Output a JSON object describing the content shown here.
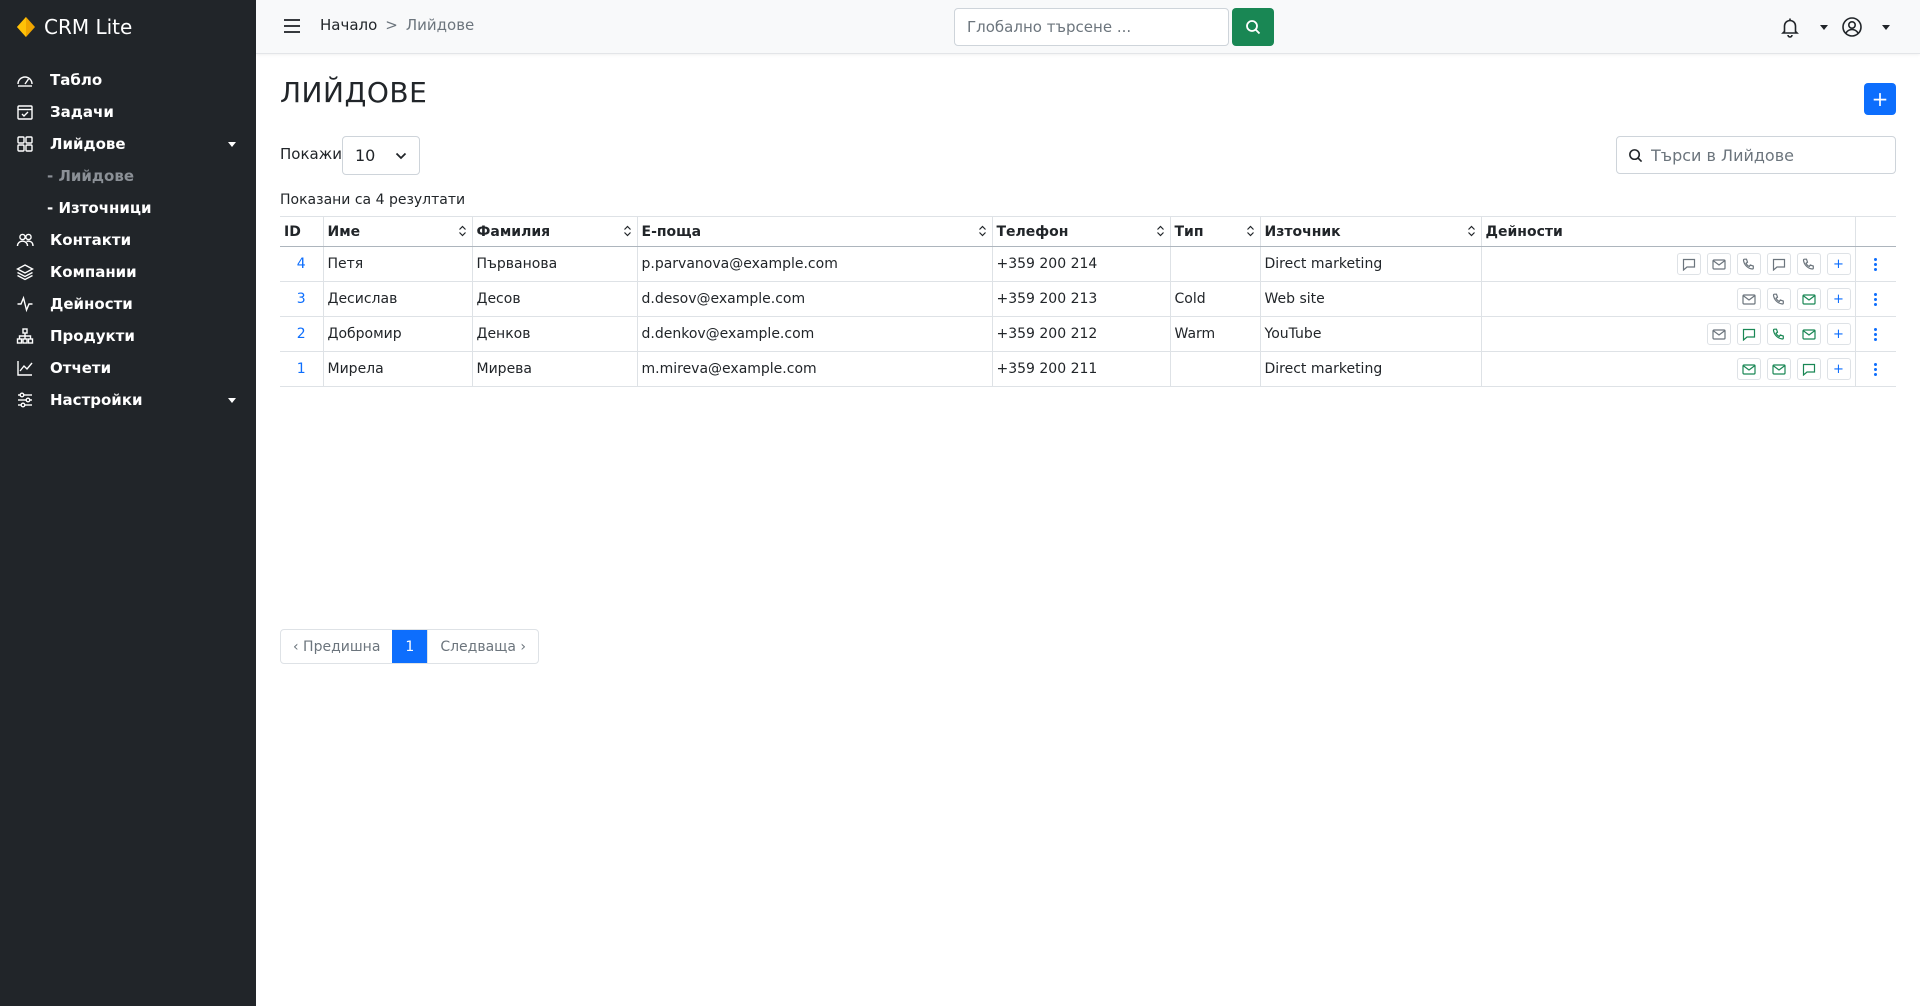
{
  "app": {
    "name": "CRM Lite"
  },
  "sidebar": {
    "items": [
      {
        "label": "Табло",
        "icon": "dashboard-icon"
      },
      {
        "label": "Задачи",
        "icon": "calendar-check-icon"
      },
      {
        "label": "Лийдове",
        "icon": "grid-icon",
        "expanded": true
      },
      {
        "label": "Контакти",
        "icon": "people-icon"
      },
      {
        "label": "Компании",
        "icon": "layers-icon"
      },
      {
        "label": "Дейности",
        "icon": "activity-icon"
      },
      {
        "label": "Продукти",
        "icon": "diagram-icon"
      },
      {
        "label": "Отчети",
        "icon": "line-chart-icon"
      },
      {
        "label": "Настройки",
        "icon": "sliders-icon",
        "has_submenu": true
      }
    ],
    "leads_subitems": [
      {
        "label": "- Лийдове",
        "active": true
      },
      {
        "label": "- Източници",
        "active": false
      }
    ]
  },
  "topbar": {
    "breadcrumb_home": "Начало",
    "breadcrumb_sep": ">",
    "breadcrumb_current": "Лийдове",
    "search_placeholder": "Глобално търсене ...",
    "search_button_color": "#198754"
  },
  "main": {
    "title": "ЛИЙДОВЕ",
    "show_label": "Покажи",
    "page_size": "10",
    "search_placeholder": "Търси в Лийдове",
    "results_text": "Показани са 4 резултати",
    "accent_color": "#0d6efd"
  },
  "table": {
    "columns": [
      "ID",
      "Име",
      "Фамилия",
      "Е-поща",
      "Телефон",
      "Тип",
      "Източник",
      "Дейности"
    ],
    "rows": [
      {
        "id": "4",
        "first": "Петя",
        "last": "Първанова",
        "email": "p.parvanova@example.com",
        "phone": "+359 200 214",
        "type": "",
        "source": "Direct marketing",
        "activities": [
          {
            "icon": "chat-icon",
            "color": "#6c757d"
          },
          {
            "icon": "envelope-icon",
            "color": "#6c757d"
          },
          {
            "icon": "phone-icon",
            "color": "#6c757d"
          },
          {
            "icon": "chat-icon",
            "color": "#6c757d"
          },
          {
            "icon": "phone-icon",
            "color": "#6c757d"
          }
        ]
      },
      {
        "id": "3",
        "first": "Десислав",
        "last": "Десов",
        "email": "d.desov@example.com",
        "phone": "+359 200 213",
        "type": "Cold",
        "source": "Web site",
        "activities": [
          {
            "icon": "envelope-icon",
            "color": "#6c757d"
          },
          {
            "icon": "phone-icon",
            "color": "#6c757d"
          },
          {
            "icon": "envelope-icon",
            "color": "#198754"
          }
        ]
      },
      {
        "id": "2",
        "first": "Добромир",
        "last": "Денков",
        "email": "d.denkov@example.com",
        "phone": "+359 200 212",
        "type": "Warm",
        "source": "YouTube",
        "activities": [
          {
            "icon": "envelope-icon",
            "color": "#6c757d"
          },
          {
            "icon": "chat-icon",
            "color": "#198754"
          },
          {
            "icon": "phone-icon",
            "color": "#198754"
          },
          {
            "icon": "envelope-icon",
            "color": "#198754"
          }
        ]
      },
      {
        "id": "1",
        "first": "Мирела",
        "last": "Мирева",
        "email": "m.mireva@example.com",
        "phone": "+359 200 211",
        "type": "",
        "source": "Direct marketing",
        "activities": [
          {
            "icon": "envelope-icon",
            "color": "#198754"
          },
          {
            "icon": "envelope-icon",
            "color": "#198754"
          },
          {
            "icon": "chat-icon",
            "color": "#198754"
          }
        ]
      }
    ]
  },
  "pagination": {
    "prev": "‹ Предишна",
    "current": "1",
    "next": "Следваща ›"
  }
}
